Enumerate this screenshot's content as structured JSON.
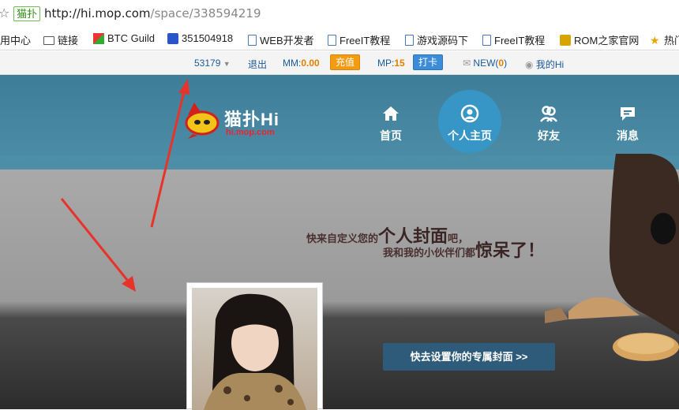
{
  "browser": {
    "tag": "猫扑",
    "url_host": "http://hi.mop.com",
    "url_path": "/space/338594219"
  },
  "bookmarks": [
    {
      "label": "用中心",
      "icon": "none"
    },
    {
      "label": "链接",
      "icon": "folder-icon"
    },
    {
      "label": "BTC Guild",
      "icon": "btc-icon"
    },
    {
      "label": "351504918",
      "icon": "paw-icon"
    },
    {
      "label": "WEB开发者",
      "icon": "doc-icon"
    },
    {
      "label": "FreeIT教程",
      "icon": "doc-icon"
    },
    {
      "label": "游戏源码下",
      "icon": "doc-icon"
    },
    {
      "label": "FreeIT教程",
      "icon": "doc-icon"
    },
    {
      "label": "ROM之家官网",
      "icon": "rom-icon"
    },
    {
      "label": "热门",
      "icon": "star-icon"
    }
  ],
  "topbar": {
    "user_id": "53179",
    "logout": "退出",
    "mm_label": "MM:",
    "mm_value": "0.00",
    "recharge": "充值",
    "mp_label": "MP:",
    "mp_value": "15",
    "checkin": "打卡",
    "new_label": "NEW(",
    "new_count": "0",
    "new_close": ")",
    "my_hi": "我的Hi"
  },
  "logo": {
    "name": "猫扑Hi",
    "domain": "hi.mop.com"
  },
  "nav": [
    {
      "label": "首页",
      "icon": "home-icon"
    },
    {
      "label": "个人主页",
      "icon": "user-icon"
    },
    {
      "label": "好友",
      "icon": "friends-icon"
    },
    {
      "label": "消息",
      "icon": "message-icon"
    }
  ],
  "cover": {
    "line1_a": "快来自定义您的",
    "line1_big": "个人封面",
    "line1_b": "吧，",
    "line2_a": "我和我的小伙伴们都",
    "line2_big": "惊呆了！",
    "set_cover_button": "快去设置你的专属封面 >>"
  },
  "colors": {
    "header": "#4589a3",
    "nav_active": "#3796c6",
    "button": "#2f5b7a",
    "arrow": "#e8332a"
  }
}
